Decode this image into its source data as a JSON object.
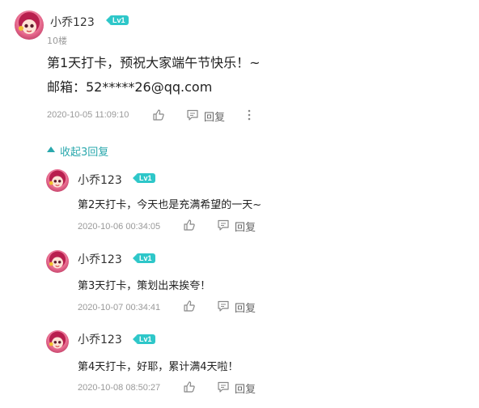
{
  "main_comment": {
    "username": "小乔123",
    "level": "Lv1",
    "floor": "10楼",
    "content_line1": "第1天打卡，预祝大家端午节快乐！~",
    "content_line2": "邮箱：52*****26@qq.com",
    "timestamp": "2020-10-05 11:09:10",
    "reply_label": "回复",
    "more_icon": "more-vertical-icon"
  },
  "collapse_replies": {
    "label": "收起3回复"
  },
  "replies": [
    {
      "username": "小乔123",
      "level": "Lv1",
      "content": "第2天打卡，今天也是充满希望的一天~",
      "timestamp": "2020-10-06 00:34:05",
      "reply_label": "回复"
    },
    {
      "username": "小乔123",
      "level": "Lv1",
      "content": "第3天打卡，策划出来挨夸！",
      "timestamp": "2020-10-07 00:34:41",
      "reply_label": "回复"
    },
    {
      "username": "小乔123",
      "level": "Lv1",
      "content": "第4天打卡，好耶，累计满4天啦！",
      "timestamp": "2020-10-08 08:50:27",
      "reply_label": "回复"
    }
  ],
  "colors": {
    "level_badge": "#2ec7c9",
    "collapse_link": "#2aa8ad",
    "meta_text": "#999999"
  }
}
